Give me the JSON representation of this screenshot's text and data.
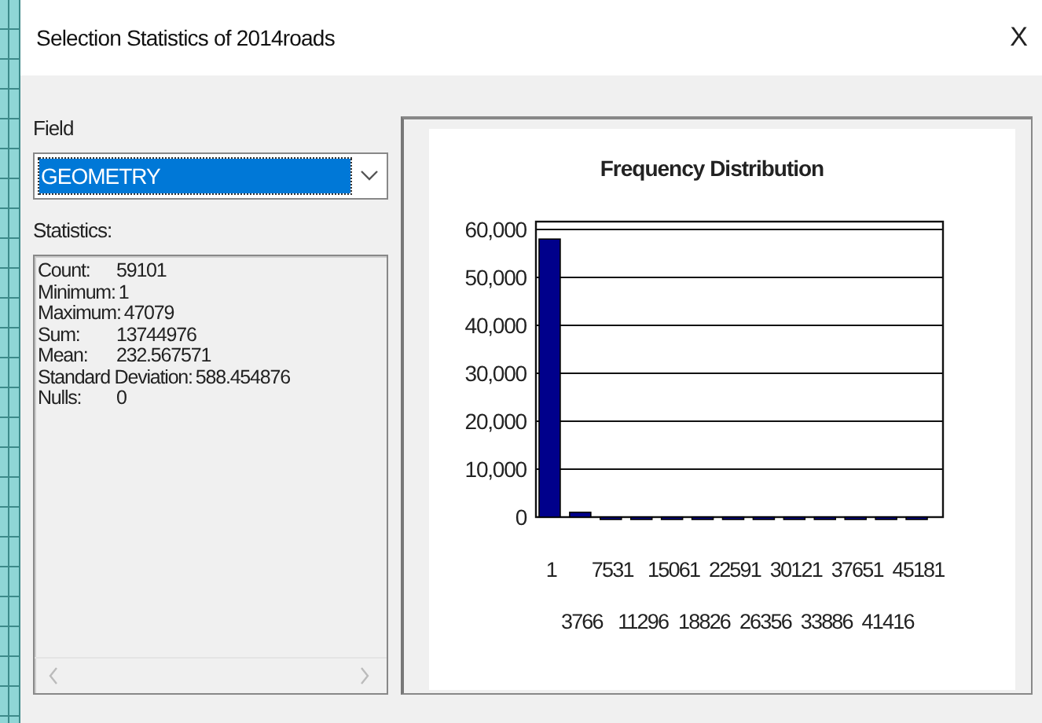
{
  "window": {
    "title": "Selection Statistics of 2014roads",
    "close": "X"
  },
  "field": {
    "label": "Field",
    "value": "GEOMETRY",
    "highlighted": true
  },
  "statistics": {
    "label": "Statistics:",
    "rows": [
      {
        "label": "Count:",
        "value": "59101"
      },
      {
        "label": "Minimum:",
        "value": "1"
      },
      {
        "label": "Maximum:",
        "value": "47079"
      },
      {
        "label": "Sum:",
        "value": "13744976"
      },
      {
        "label": "Mean:",
        "value": "232.567571"
      },
      {
        "label": "Standard Deviation:",
        "value": "588.454876"
      },
      {
        "label": "Nulls:",
        "value": "0"
      }
    ]
  },
  "chart": {
    "chart_data": {
      "type": "bar",
      "title": "Frequency Distribution",
      "categories": [
        "1",
        "3766",
        "7531",
        "11296",
        "15061",
        "18826",
        "22591",
        "26356",
        "30121",
        "33886",
        "37651",
        "41416",
        "45181"
      ],
      "series": [
        {
          "color": "#00008b",
          "values": [
            58000,
            1000,
            0,
            0,
            0,
            0,
            0,
            0,
            0,
            0,
            0,
            0,
            0
          ]
        }
      ],
      "grid": true,
      "ylim": [
        0,
        60000
      ],
      "yticks": [
        {
          "value": 0,
          "label": "0"
        },
        {
          "value": 10000,
          "label": "10,000"
        },
        {
          "value": 20000,
          "label": "20,000"
        },
        {
          "value": 30000,
          "label": "30,000"
        },
        {
          "value": 40000,
          "label": "40,000"
        },
        {
          "value": 50000,
          "label": "50,000"
        },
        {
          "value": 60000,
          "label": "60,000"
        }
      ]
    }
  }
}
